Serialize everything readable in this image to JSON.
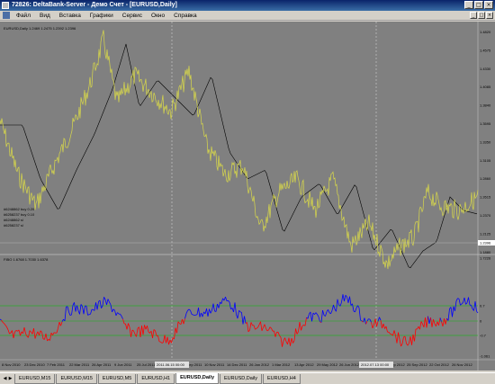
{
  "window": {
    "title": "72826: DeltaBank-Server - Демо Счет - [EURUSD,Daily]",
    "buttons": [
      "_",
      "□",
      "×"
    ]
  },
  "menu": {
    "items": [
      "Файл",
      "Вид",
      "Вставка",
      "Графики",
      "Сервис",
      "Окно",
      "Справка"
    ],
    "mdi_buttons": [
      "_",
      "□",
      "×"
    ]
  },
  "main_chart": {
    "header": "EURUSD,Daily  1.2469 1.2475 1.2392 1.2396",
    "price_labels": [
      "1.4820",
      "1.4575",
      "1.4330",
      "1.4085",
      "1.3840",
      "1.3595",
      "1.3350",
      "1.3105",
      "1.2860",
      "1.2615",
      "1.2370",
      "1.2125",
      "1.1880"
    ],
    "current_price": "1.2396",
    "object_lines": [
      "#6248862 buy 0.20",
      "#6258237 buy 0.10",
      "#6248862 sl",
      "#6258237 sl"
    ]
  },
  "indicator": {
    "header": "FIBO 1.6768 1.7030 1.6378",
    "scale_labels": [
      "1.7226",
      "0.7",
      "0",
      "-0.7",
      "-1.061"
    ]
  },
  "time_axis": {
    "labels": [
      "8 Nov 2010",
      "23 Dec 2010",
      "7 Feb 2011",
      "22 Mar 2011",
      "26 Apr 2011",
      "9 Jun 2011",
      "25 Jul 2011",
      "6 Sep 2011",
      "27 Sep 2011",
      "10 Nov 2011",
      "14 Dec 2011",
      "26 Jan 2012",
      "1 Mar 2012",
      "13 Apr 2012",
      "29 May 2012",
      "26 Jun 2012",
      "8 Aug 2012",
      "19 Sep 2012",
      "25 Sep 2012",
      "22 Oct 2012",
      "26 Nov 2012"
    ],
    "highlight_1": "2011.06.15 00:00",
    "highlight_2": "2012.07.13 00:00"
  },
  "tabs": {
    "items": [
      "EURUSD,M15",
      "EURUSD,M15",
      "EURUSD,M5",
      "EURUSD,H1",
      "EURUSD,Daily",
      "EURUSD,Daily",
      "EURUSD,H4"
    ],
    "active_index": 4
  },
  "colors": {
    "price_line": "#d8d84a",
    "ma_line": "#000000",
    "osc_up": "#0000ff",
    "osc_down": "#ff0000",
    "level_line": "#00c000",
    "background": "#808080"
  }
}
